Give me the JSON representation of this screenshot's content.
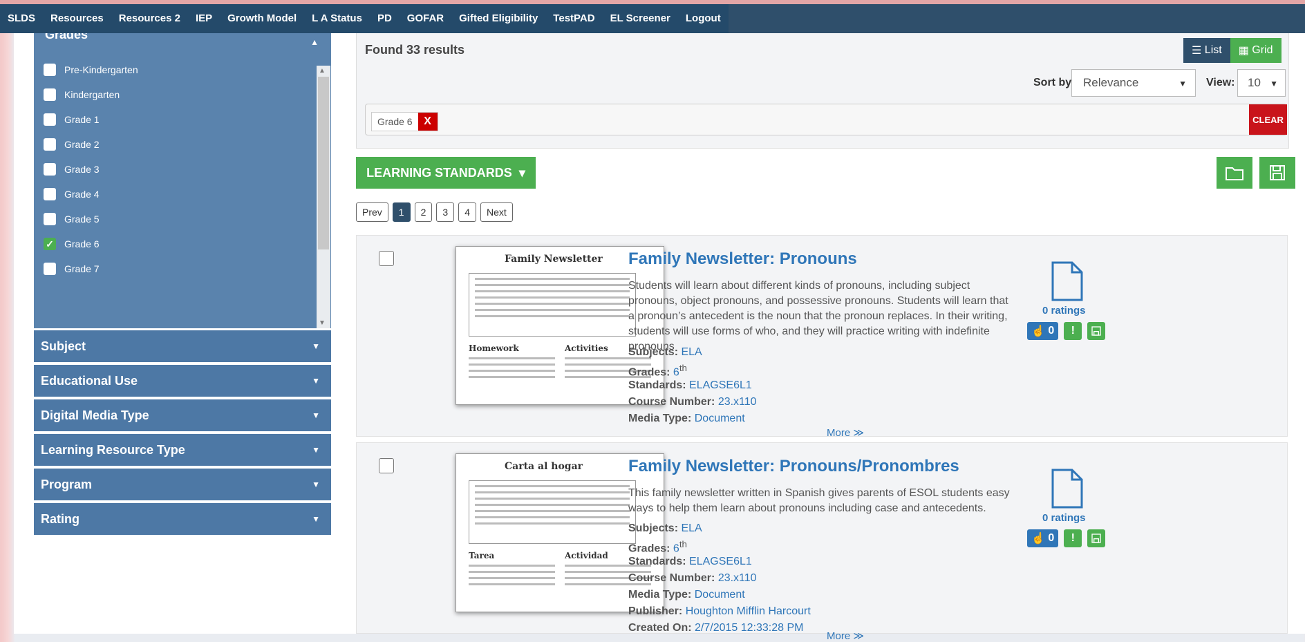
{
  "topnav": {
    "items": [
      "SLDS",
      "Resources",
      "Resources 2",
      "IEP",
      "Growth Model",
      "L A Status",
      "PD",
      "GOFAR",
      "Gifted Eligibility",
      "TestPAD",
      "EL Screener",
      "Logout"
    ]
  },
  "sidebar": {
    "grades_title": "Grades",
    "grades": [
      {
        "label": "Pre-Kindergarten",
        "checked": false
      },
      {
        "label": "Kindergarten",
        "checked": false
      },
      {
        "label": "Grade 1",
        "checked": false
      },
      {
        "label": "Grade 2",
        "checked": false
      },
      {
        "label": "Grade 3",
        "checked": false
      },
      {
        "label": "Grade 4",
        "checked": false
      },
      {
        "label": "Grade 5",
        "checked": false
      },
      {
        "label": "Grade 6",
        "checked": true
      },
      {
        "label": "Grade 7",
        "checked": false
      }
    ],
    "sections": [
      "Subject",
      "Educational Use",
      "Digital Media Type",
      "Learning Resource Type",
      "Program",
      "Rating"
    ]
  },
  "results": {
    "found": "Found 33 results",
    "list_label": "List",
    "grid_label": "Grid",
    "sort_label": "Sort by:",
    "sort_value": "Relevance",
    "view_label": "View:",
    "view_value": "10",
    "tag_text": "Grade 6",
    "tag_remove": "X",
    "clear_label": "CLEAR",
    "learning_standards": "LEARNING STANDARDS",
    "pager": [
      "Prev",
      "1",
      "2",
      "3",
      "4",
      "Next"
    ]
  },
  "cards": [
    {
      "thumb_title": "Family Newsletter",
      "thumb_left_header": "Homework",
      "thumb_right_header": "Activities",
      "title": "Family Newsletter: Pronouns",
      "description": "Students will learn about different kinds of pronouns, including subject pronouns, object pronouns, and possessive pronouns. Students will learn that a pronoun’s antecedent is the noun that the pronoun replaces. In their writing, students will use forms of who, and they will practice writing with indefinite pronouns",
      "subjects_label": "Subjects:",
      "subjects": "ELA",
      "grades_label": "Grades:",
      "grades": "6",
      "grades_sup": "th",
      "standards_label": "Standards:",
      "standards": "ELAGSE6L1",
      "course_label": "Course Number:",
      "course": "23.x110",
      "media_label": "Media Type:",
      "media": "Document",
      "ratings": "0 ratings",
      "likes": "0",
      "more": "More ≫"
    },
    {
      "thumb_title": "Carta al hogar",
      "thumb_left_header": "Tarea",
      "thumb_right_header": "Actividad",
      "title": "Family Newsletter: Pronouns/Pronombres",
      "description": "This family newsletter written in Spanish gives parents of ESOL students easy ways to help them learn about pronouns including case and antecedents.",
      "subjects_label": "Subjects:",
      "subjects": "ELA",
      "grades_label": "Grades:",
      "grades": "6",
      "grades_sup": "th",
      "standards_label": "Standards:",
      "standards": "ELAGSE6L1",
      "course_label": "Course Number:",
      "course": "23.x110",
      "media_label": "Media Type:",
      "media": "Document",
      "publisher_label": "Publisher:",
      "publisher": "Houghton Mifflin Harcourt",
      "created_label": "Created On:",
      "created": "2/7/2015 12:33:28 PM",
      "ratings": "0 ratings",
      "likes": "0",
      "more": "More ≫"
    }
  ],
  "colors": {
    "nav": "#244a6a",
    "sidebar": "#5a83ad",
    "accent_green": "#4caf50",
    "danger": "#c9141b",
    "link": "#2f76b8"
  }
}
